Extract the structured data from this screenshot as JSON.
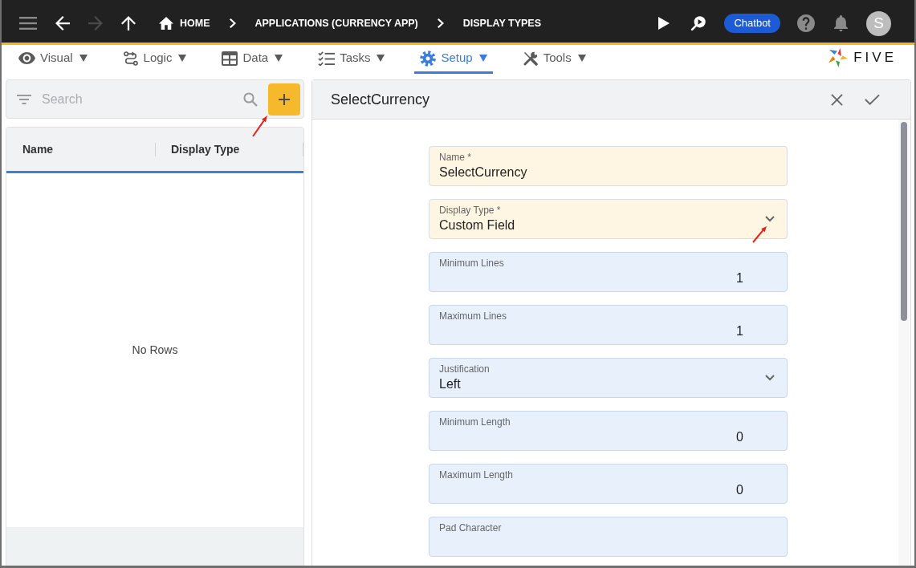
{
  "top_bar": {
    "nav_buttons": [
      {
        "kind": "back",
        "disabled": false
      },
      {
        "kind": "forward",
        "disabled": true
      },
      {
        "kind": "up",
        "disabled": false
      }
    ],
    "breadcrumbs": [
      {
        "kind": "home",
        "label": "HOME"
      },
      {
        "kind": "page",
        "label": "APPLICATIONS (CURRENCY APP)"
      },
      {
        "kind": "page",
        "label": "DISPLAY TYPES"
      }
    ],
    "chatbot_button": "Chatbot",
    "avatar": "S"
  },
  "menu_bar": {
    "items": [
      {
        "label": "Visual",
        "selected": false
      },
      {
        "label": "Logic",
        "selected": false
      },
      {
        "label": "Data",
        "selected": false
      },
      {
        "label": "Tasks",
        "selected": false
      },
      {
        "label": "Setup",
        "selected": true
      },
      {
        "label": "Tools",
        "selected": false
      }
    ],
    "logo": "FIVE"
  },
  "list_panel": {
    "search": {
      "placeholder": "Search"
    },
    "table": {
      "columns": [
        "Name",
        "Display Type"
      ],
      "empty_text": "No Rows"
    }
  },
  "form_panel": {
    "title": "SelectCurrency",
    "fields": [
      {
        "kind": "text",
        "label": "Name *",
        "value": "SelectCurrency",
        "required": true
      },
      {
        "kind": "select",
        "label": "Display Type *",
        "value": "Custom Field",
        "required": true
      },
      {
        "kind": "number",
        "label": "Minimum Lines",
        "value": "1",
        "required": false
      },
      {
        "kind": "number",
        "label": "Maximum Lines",
        "value": "1",
        "required": false
      },
      {
        "kind": "select",
        "label": "Justification",
        "value": "Left",
        "required": false
      },
      {
        "kind": "number",
        "label": "Minimum Length",
        "value": "0",
        "required": false
      },
      {
        "kind": "number",
        "label": "Maximum Length",
        "value": "0",
        "required": false
      },
      {
        "kind": "text",
        "label": "Pad Character",
        "required": false
      }
    ]
  }
}
